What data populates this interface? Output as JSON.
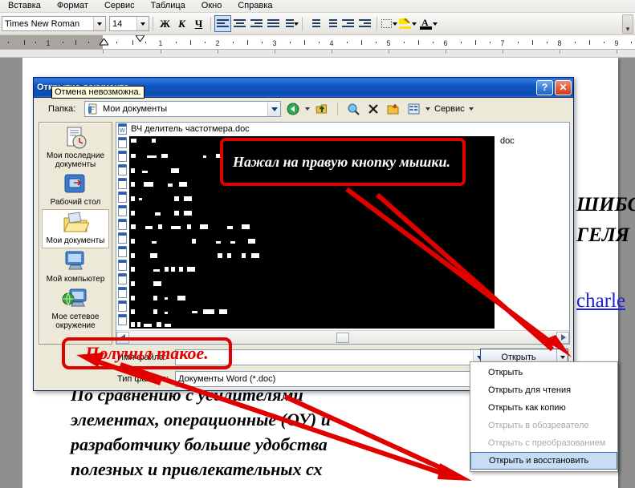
{
  "app": {
    "menubar": [
      "Вставка",
      "Формат",
      "Сервис",
      "Таблица",
      "Окно",
      "Справка"
    ],
    "toolbar": {
      "font_name": "Times New Roman",
      "font_size": "14",
      "bold_glyph": "Ж",
      "italic_glyph": "К",
      "underline_glyph": "Ч",
      "icons": [
        "align-left-icon",
        "align-center-icon",
        "align-right-icon",
        "align-justify-icon",
        "line-spacing-icon",
        "numbered-list-icon",
        "bulleted-list-icon",
        "decrease-indent-icon",
        "increase-indent-icon",
        "borders-icon",
        "highlight-icon",
        "font-color-icon"
      ]
    },
    "ruler": {
      "ticks": [
        "1",
        "2",
        "3",
        "4",
        "5",
        "6",
        "7",
        "8",
        "9"
      ],
      "left_label": "1"
    }
  },
  "document": {
    "right_fragments": [
      "ШИБС",
      "ГЕЛЯ"
    ],
    "link_fragment": "charle",
    "body_lines": [
      "По сравнению с усилителями",
      "элементах, операционные (ОУ) и",
      "разработчику большие удобства",
      "полезных и привлекательных сх"
    ]
  },
  "dialog": {
    "title": "Открытие документа",
    "tooltip": "Отмена невозможна.",
    "help_button": "?",
    "close_button": "✕",
    "look_in_label": "Папка:",
    "look_in_value": "Мои документы",
    "toolbar_icons": [
      "back-icon",
      "up-one-level-icon",
      "search-web-icon",
      "delete-icon",
      "new-folder-icon",
      "views-icon"
    ],
    "tools_menu": "Сервис",
    "places": [
      {
        "label": "Мои последние документы",
        "icon": "recent-documents-icon",
        "selected": false
      },
      {
        "label": "Рабочий стол",
        "icon": "desktop-icon",
        "selected": false
      },
      {
        "label": "Мои документы",
        "icon": "my-documents-icon",
        "selected": true
      },
      {
        "label": "Мой компьютер",
        "icon": "my-computer-icon",
        "selected": false
      },
      {
        "label": "Мое сетевое окружение",
        "icon": "network-places-icon",
        "selected": false
      }
    ],
    "files": [
      {
        "name": "ВЧ делитель частотмера.doc",
        "corrupt": false
      },
      {
        "name": "",
        "corrupt": true
      },
      {
        "name": "",
        "corrupt": true
      },
      {
        "name": "",
        "corrupt": true
      },
      {
        "name": "",
        "corrupt": true
      },
      {
        "name": "",
        "corrupt": true
      },
      {
        "name": "",
        "corrupt": true
      },
      {
        "name": "",
        "corrupt": true
      },
      {
        "name": "",
        "corrupt": true
      },
      {
        "name": "",
        "corrupt": true
      },
      {
        "name": "",
        "corrupt": true
      },
      {
        "name": "",
        "corrupt": true
      },
      {
        "name": "",
        "corrupt": true
      },
      {
        "name": "",
        "corrupt": true
      },
      {
        "name": "",
        "corrupt": true
      }
    ],
    "stray_text": "doc",
    "file_name_label": "Имя файла:",
    "file_name_value": "",
    "file_type_label": "Тип файлов:",
    "file_type_value": "Документы Word (*.doc)",
    "open_button": "Открыть",
    "scrollbar_left": "◄",
    "scrollbar_right": "►"
  },
  "context_menu": {
    "items": [
      {
        "label": "Открыть",
        "disabled": false,
        "highlighted": false
      },
      {
        "label": "Открыть для чтения",
        "disabled": false,
        "highlighted": false
      },
      {
        "label": "Открыть как копию",
        "disabled": false,
        "highlighted": false
      },
      {
        "label": "Открыть в обозревателе",
        "disabled": true,
        "highlighted": false
      },
      {
        "label": "Открыть с преобразованием",
        "disabled": true,
        "highlighted": false
      },
      {
        "label": "Открыть и восстановить",
        "disabled": false,
        "highlighted": true
      }
    ]
  },
  "annotations": {
    "note_1": "Нажал на правую кнопку мышки.",
    "note_2": "Получил такое.",
    "color": "#e00000"
  }
}
